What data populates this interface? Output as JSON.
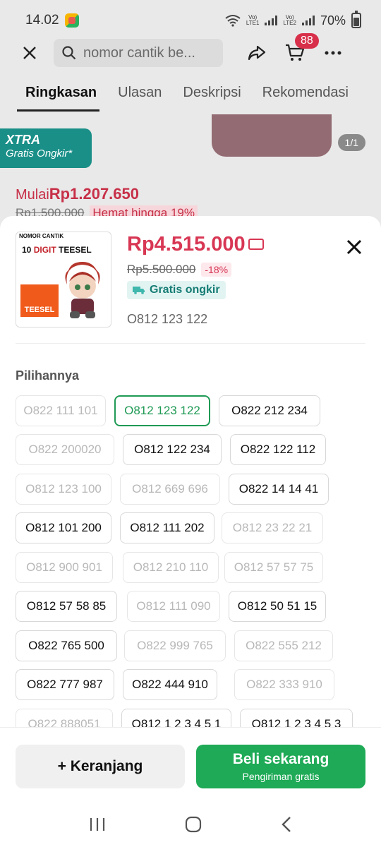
{
  "status": {
    "time": "14.02",
    "battery": "70%",
    "sim1": "LTE1",
    "sim2": "LTE2",
    "volte": "Vo)"
  },
  "topbar": {
    "search_placeholder": "nomor cantik be...",
    "cart_count": "88"
  },
  "tabs": [
    "Ringkasan",
    "Ulasan",
    "Deskripsi",
    "Rekomendasi"
  ],
  "background": {
    "xtra_title": "XTRA",
    "xtra_sub": "Gratis Ongkir*",
    "image_counter": "1/1",
    "price_prefix": "Mulai",
    "price": "Rp1.207.650",
    "old_price": "Rp1.500.000",
    "saving": "Hemat hingga 19%"
  },
  "sheet": {
    "thumb_logo": "NOMOR CANTIK",
    "thumb_title_prefix": "10 ",
    "thumb_title_mid": "DIGIT",
    "thumb_title_suffix": " TEESEL",
    "thumb_brand": "TEESEL",
    "price": "Rp4.515.000",
    "old_price": "Rp5.500.000",
    "discount": "-18%",
    "shipping": "Gratis ongkir",
    "selected_number": "O812 123 122",
    "options_label": "Pilihannya",
    "options": [
      {
        "label": "O822 111 101",
        "state": "disabled"
      },
      {
        "label": "O812 123 122",
        "state": "selected"
      },
      {
        "label": "O822 212 234",
        "state": "enabled"
      },
      {
        "label": "O822 200020",
        "state": "disabled"
      },
      {
        "label": "O812 122 234",
        "state": "enabled"
      },
      {
        "label": "O822 122 112",
        "state": "enabled"
      },
      {
        "label": "O812 123 100",
        "state": "disabled"
      },
      {
        "label": "O812 669 696",
        "state": "disabled"
      },
      {
        "label": "O822 14 14 41",
        "state": "enabled"
      },
      {
        "label": "O812 101 200",
        "state": "enabled"
      },
      {
        "label": "O812 111 202",
        "state": "enabled"
      },
      {
        "label": "O812 23 22 21",
        "state": "disabled"
      },
      {
        "label": "O812 900 901",
        "state": "disabled"
      },
      {
        "label": "O812 210 110",
        "state": "disabled"
      },
      {
        "label": "O812 57 57 75",
        "state": "disabled"
      },
      {
        "label": "O812 57 58 85",
        "state": "enabled"
      },
      {
        "label": "O812 111 090",
        "state": "disabled"
      },
      {
        "label": "O812 50 51 15",
        "state": "enabled"
      },
      {
        "label": "O822 765 500",
        "state": "enabled"
      },
      {
        "label": "O822 999 765",
        "state": "disabled"
      },
      {
        "label": "O822 555 212",
        "state": "disabled"
      },
      {
        "label": "O822 777 987",
        "state": "enabled"
      },
      {
        "label": "O822 444 910",
        "state": "enabled"
      },
      {
        "label": "O822 333 910",
        "state": "disabled"
      },
      {
        "label": "O822 888051",
        "state": "disabled"
      },
      {
        "label": "O812 1 2 3 4 5 1",
        "state": "enabled"
      },
      {
        "label": "O812 1 2 3 4 5 3",
        "state": "enabled"
      }
    ]
  },
  "footer": {
    "cart_label": "+ Keranjang",
    "buy_label": "Beli sekarang",
    "buy_sub": "Pengiriman gratis"
  },
  "colors": {
    "accent_red": "#d83754",
    "accent_green": "#1eaa56",
    "teal": "#1a8f88"
  }
}
